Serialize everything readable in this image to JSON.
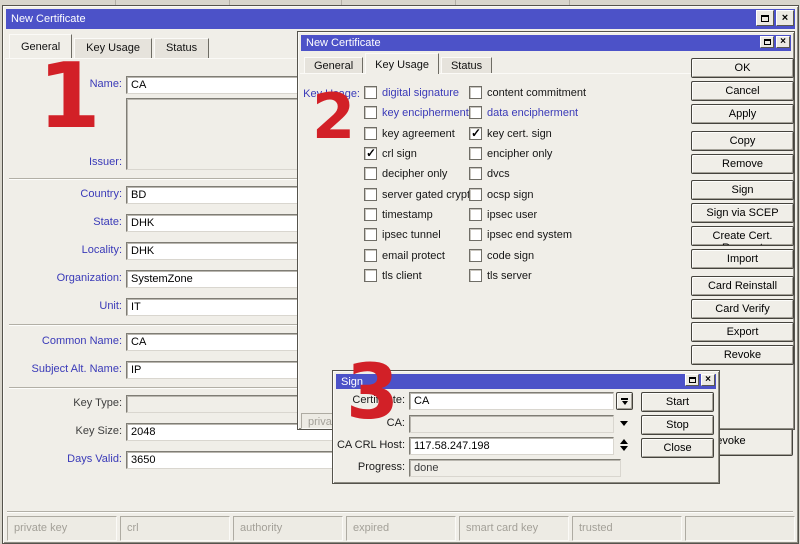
{
  "colors": {
    "titlebar": "#4c52c8",
    "label_blue": "#3a3ab8",
    "annotation_red": "#d22027",
    "face": "#f0eee8"
  },
  "icons": {
    "close": "×",
    "maximize": "window-maximize",
    "dropdown_load": "bar-down-arrow",
    "dropdown": "down-arrow",
    "spinner": "up-down-arrows",
    "check": "✓"
  },
  "annotations": {
    "one": "1",
    "two": "2",
    "three": "3"
  },
  "win1": {
    "title": "New Certificate",
    "tabs": [
      "General",
      "Key Usage",
      "Status"
    ],
    "active_tab": "General",
    "fields": {
      "name": {
        "label": "Name:",
        "value": "CA"
      },
      "issuer": {
        "label": "Issuer:",
        "value": ""
      },
      "country": {
        "label": "Country:",
        "value": "BD"
      },
      "state": {
        "label": "State:",
        "value": "DHK"
      },
      "locality": {
        "label": "Locality:",
        "value": "DHK"
      },
      "organization": {
        "label": "Organization:",
        "value": "SystemZone"
      },
      "unit": {
        "label": "Unit:",
        "value": "IT"
      },
      "common_name": {
        "label": "Common Name:",
        "value": "CA"
      },
      "subject_alt_name": {
        "label": "Subject Alt. Name:",
        "value": "IP"
      },
      "key_type": {
        "label": "Key Type:",
        "value": ""
      },
      "key_size": {
        "label": "Key Size:",
        "value": "2048"
      },
      "days_valid": {
        "label": "Days Valid:",
        "value": "3650"
      }
    },
    "revoke_label": "Revoke",
    "status_boxes": [
      "private key",
      "crl",
      "authority",
      "expired",
      "smart card key",
      "trusted",
      ""
    ]
  },
  "win2": {
    "title": "New Certificate",
    "tabs": [
      "General",
      "Key Usage",
      "Status"
    ],
    "active_tab": "Key Usage",
    "key_usage_label": "Key Usage:",
    "key_usage": {
      "left": [
        {
          "label": "digital signature",
          "checked": false,
          "highlight": true
        },
        {
          "label": "key encipherment",
          "checked": false,
          "highlight": true
        },
        {
          "label": "key agreement",
          "checked": false
        },
        {
          "label": "crl sign",
          "checked": true
        },
        {
          "label": "decipher only",
          "checked": false
        },
        {
          "label": "server gated crypto",
          "checked": false
        },
        {
          "label": "timestamp",
          "checked": false
        },
        {
          "label": "ipsec tunnel",
          "checked": false
        },
        {
          "label": "email protect",
          "checked": false
        },
        {
          "label": "tls client",
          "checked": false
        }
      ],
      "right": [
        {
          "label": "content commitment",
          "checked": false
        },
        {
          "label": "data encipherment",
          "checked": false,
          "highlight": true
        },
        {
          "label": "key cert. sign",
          "checked": true
        },
        {
          "label": "encipher only",
          "checked": false
        },
        {
          "label": "dvcs",
          "checked": false
        },
        {
          "label": "ocsp sign",
          "checked": false
        },
        {
          "label": "ipsec user",
          "checked": false
        },
        {
          "label": "ipsec end system",
          "checked": false
        },
        {
          "label": "code sign",
          "checked": false
        },
        {
          "label": "tls server",
          "checked": false
        }
      ]
    },
    "buttons": [
      "OK",
      "Cancel",
      "Apply",
      "Copy",
      "Remove",
      "Sign",
      "Sign via SCEP",
      "Create Cert. Request",
      "Import",
      "Card Reinstall",
      "Card Verify",
      "Export",
      "Revoke"
    ],
    "status_fragment": "private key"
  },
  "win3": {
    "title": "Sign",
    "fields": {
      "certificate": {
        "label": "Certificate:",
        "value": "CA"
      },
      "ca": {
        "label": "CA:",
        "value": ""
      },
      "ca_crl_host": {
        "label": "CA CRL Host:",
        "value": "117.58.247.198"
      },
      "progress": {
        "label": "Progress:",
        "value": "done"
      }
    },
    "buttons": [
      "Start",
      "Stop",
      "Close"
    ]
  }
}
